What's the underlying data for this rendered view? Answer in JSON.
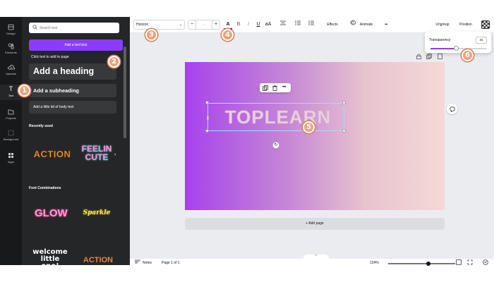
{
  "colors": {
    "brand_purple": "#8b3dff",
    "rail_bg": "#18191b",
    "panel_bg": "#252627",
    "marker": "#f2a07b"
  },
  "rail": {
    "items": [
      {
        "label": "Design",
        "icon": "design-icon"
      },
      {
        "label": "Elements",
        "icon": "elements-icon"
      },
      {
        "label": "Uploads",
        "icon": "uploads-icon"
      },
      {
        "label": "Text",
        "icon": "text-icon"
      },
      {
        "label": "Projects",
        "icon": "projects-icon"
      },
      {
        "label": "Background",
        "icon": "background-icon"
      },
      {
        "label": "Apps",
        "icon": "apps-icon"
      }
    ]
  },
  "panel": {
    "search_placeholder": "Search text",
    "add_text_box": "Add a text box",
    "click_hint": "Click text to add to page",
    "heading": "Add a heading",
    "subheading": "Add a subheading",
    "body": "Add a little bit of body text",
    "recently_used": "Recently used",
    "recent_items": [
      "ACTION",
      "FEELIN CUTE"
    ],
    "font_combinations": "Font Combinations",
    "combo_items": [
      "GLOW",
      "Sparkle",
      "welcome little one!",
      "ACTION"
    ]
  },
  "toolbar": {
    "font": "Horizon",
    "minus": "−",
    "size": "--",
    "plus": "+",
    "text_color_glyph": "A",
    "bold": "B",
    "italic": "I",
    "underline": "U",
    "case": "aA",
    "effects": "Effects",
    "animate": "Animate",
    "more": "•••",
    "ungroup": "Ungroup",
    "position": "Position"
  },
  "canvas": {
    "design_text": "TOPLEARN",
    "add_page": "+ Add page"
  },
  "transparency": {
    "label": "Transparency",
    "value": "4s",
    "level": 0.45
  },
  "status": {
    "notes": "Notes",
    "page": "Page 1 of 1",
    "zoom": "124%",
    "zoom_level": 0.6
  },
  "markers": [
    "1",
    "2",
    "3",
    "4",
    "5",
    "6"
  ]
}
